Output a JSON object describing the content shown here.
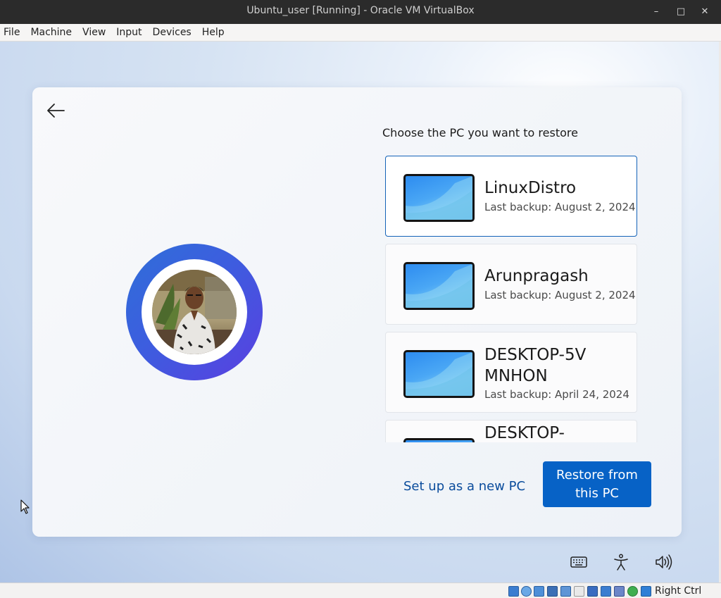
{
  "window": {
    "title": "Ubuntu_user [Running] - Oracle VM VirtualBox",
    "controls": {
      "minimize": "–",
      "maximize": "□",
      "close": "✕"
    }
  },
  "menu": [
    "File",
    "Machine",
    "View",
    "Input",
    "Devices",
    "Help"
  ],
  "setup": {
    "heading": "Choose the PC you want to restore",
    "pcs": [
      {
        "name": "LinuxDistro",
        "backup": "Last backup: August 2, 2024",
        "selected": true
      },
      {
        "name": "Arunpragash",
        "backup": "Last backup: August 2, 2024",
        "selected": false
      },
      {
        "name": "DESKTOP-5VMNHON",
        "backup": "Last backup: April 24, 2024",
        "selected": false
      },
      {
        "name": "DESKTOP-",
        "backup": "",
        "selected": false
      }
    ],
    "setup_new": "Set up as a new PC",
    "restore_button": "Restore from this PC"
  },
  "bottom_icons": [
    "keyboard-icon",
    "accessibility-icon",
    "volume-icon"
  ],
  "statusbar": {
    "host_key": "Right Ctrl",
    "icons": [
      "hard-disk-icon",
      "optical-drive-icon",
      "audio-icon",
      "network-icon",
      "usb-icon",
      "shared-folders-icon",
      "display-icon",
      "recording-icon",
      "virtualization-icon",
      "mouse-integration-icon",
      "download-icon"
    ]
  },
  "colors": {
    "accent": "#0762c6",
    "link": "#0a4c9c",
    "selected_border": "#1463b8"
  }
}
